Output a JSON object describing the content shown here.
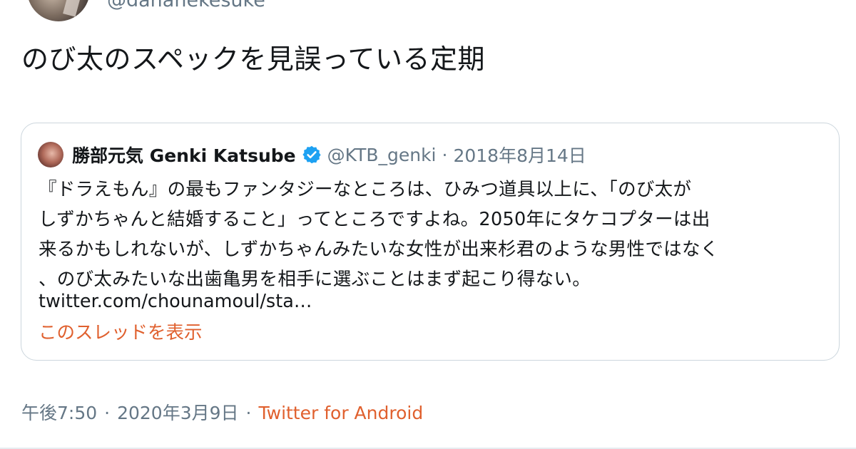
{
  "header": {
    "handle": "@dananekesuke"
  },
  "tweet": {
    "text": "のび太のスペックを見誤っている定期"
  },
  "quote": {
    "display_name": "勝部元気 Genki Katsube",
    "handle": "@KTB_genki",
    "separator": "·",
    "date": "2018年8月14日",
    "body_lines": [
      "『ドラえもん』の最もファンタジーなところは、ひみつ道具以上に、「のび太が",
      "しずかちゃんと結婚すること」ってところですよね。2050年にタケコプターは出",
      "来るかもしれないが、しずかちゃんみたいな女性が出来杉君のような男性ではなく",
      "、のび太みたいな出歯亀男を相手に選ぶことはまず起こり得ない。"
    ],
    "link": "twitter.com/chounamoul/sta…",
    "show_thread": "このスレッドを表示"
  },
  "meta": {
    "time": "午後7:50",
    "separator": "·",
    "date": "2020年3月9日",
    "separator2": "·",
    "source": "Twitter for Android"
  },
  "colors": {
    "accent": "#e0602e",
    "secondary_text": "#657786",
    "verified": "#1da1f2",
    "border": "#ccd6dd"
  },
  "icons": {
    "verified": "verified-badge-icon"
  }
}
